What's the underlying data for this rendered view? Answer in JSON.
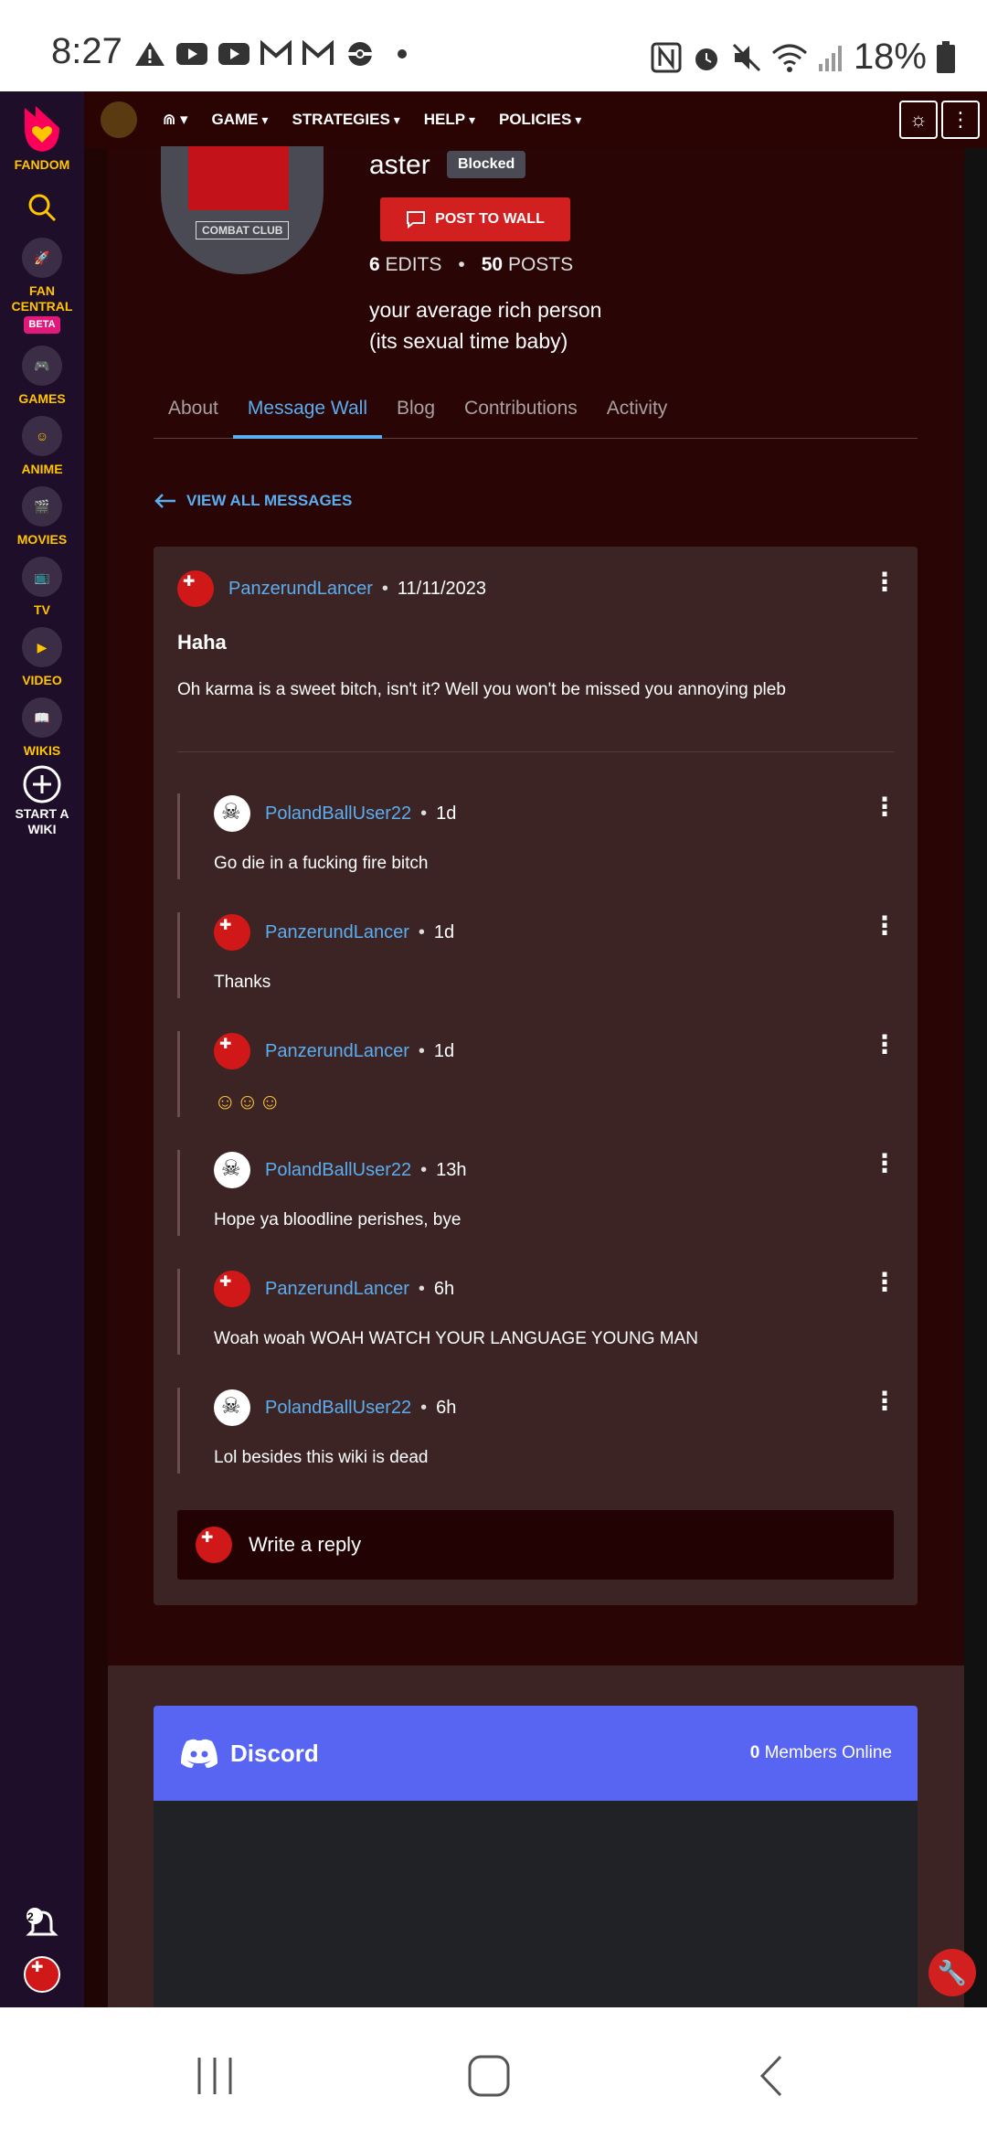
{
  "status_bar": {
    "time": "8:27",
    "battery": "18%",
    "left_icons": [
      "warning-icon",
      "youtube-icon",
      "youtube-icon",
      "gmail-icon",
      "gmail-icon",
      "pokeball-icon",
      "dot-icon"
    ],
    "right_icons": [
      "nfc-icon",
      "alarm-icon",
      "mute-icon",
      "wifi-icon",
      "signal-icon",
      "battery-icon"
    ]
  },
  "sidebar": {
    "items": [
      {
        "label": "FANDOM"
      },
      {
        "label": "FAN CENTRAL",
        "badge": "BETA"
      },
      {
        "label": "GAMES"
      },
      {
        "label": "ANIME"
      },
      {
        "label": "MOVIES"
      },
      {
        "label": "TV"
      },
      {
        "label": "VIDEO"
      },
      {
        "label": "WIKIS"
      },
      {
        "label": "START A WIKI"
      }
    ],
    "notification_count": "2"
  },
  "wiki_nav": {
    "menu": [
      "GAME",
      "STRATEGIES",
      "HELP",
      "POLICIES"
    ]
  },
  "profile": {
    "username": "aster",
    "blocked_badge": "Blocked",
    "post_button": "POST TO WALL",
    "avatar_text": "COMBAT CLUB",
    "edits_count": "6",
    "edits_label": "EDITS",
    "posts_count": "50",
    "posts_label": "POSTS",
    "bio_line1": "your average rich person",
    "bio_line2": "(its sexual time baby)"
  },
  "tabs": [
    "About",
    "Message Wall",
    "Blog",
    "Contributions",
    "Activity"
  ],
  "view_all": "VIEW ALL MESSAGES",
  "thread": {
    "author": "PanzerundLancer",
    "date": "11/11/2023",
    "title": "Haha",
    "body": "Oh karma is a sweet bitch, isn't it? Well you won't be missed you annoying pleb",
    "replies": [
      {
        "author": "PolandBallUser22",
        "time": "1d",
        "text": "Go die in a fucking fire bitch"
      },
      {
        "author": "PanzerundLancer",
        "time": "1d",
        "text": "Thanks"
      },
      {
        "author": "PanzerundLancer",
        "time": "1d",
        "text": "☺☺☺"
      },
      {
        "author": "PolandBallUser22",
        "time": "13h",
        "text": "Hope ya bloodline perishes, bye"
      },
      {
        "author": "PanzerundLancer",
        "time": "6h",
        "text": "Woah woah WOAH WATCH YOUR LANGUAGE YOUNG MAN"
      },
      {
        "author": "PolandBallUser22",
        "time": "6h",
        "text": "Lol besides this wiki is dead"
      }
    ],
    "write_reply": "Write a reply"
  },
  "discord": {
    "name": "Discord",
    "members_count": "0",
    "members_label": "Members Online"
  },
  "colors": {
    "accent_link": "#5aaef0",
    "fandom_yellow": "#ffc500",
    "button_red": "#d21f1f",
    "discord": "#5865f2"
  }
}
